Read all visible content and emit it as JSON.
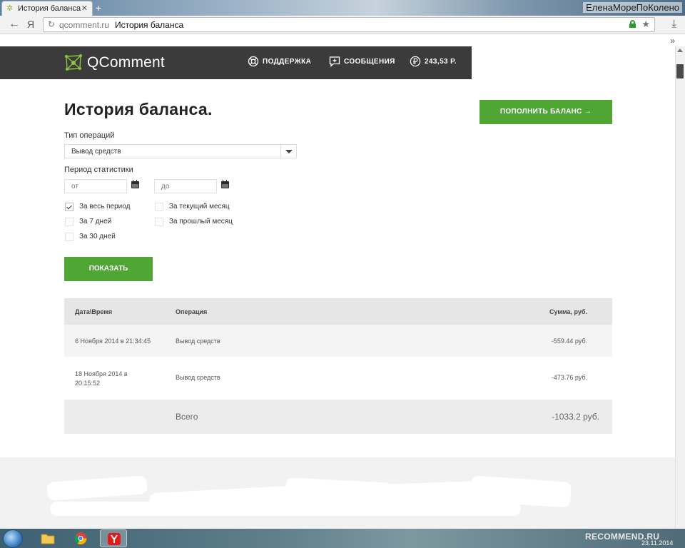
{
  "browser": {
    "tab_title": "История баланса",
    "profile_name": "ЕленаМореПоКолено",
    "ya_label": "Я",
    "url_domain": "qcomment.ru",
    "url_page_title": "История баланса",
    "new_tab": "+",
    "close_tab": "✕",
    "more": "»"
  },
  "header": {
    "logo": "QComment",
    "nav": [
      {
        "label": "ПОДДЕРЖКА",
        "icon": "lifebuoy-icon"
      },
      {
        "label": "СООБЩЕНИЯ",
        "icon": "message-plus-icon"
      },
      {
        "label": "243,53 Р.",
        "icon": "ruble-coin-icon"
      }
    ]
  },
  "page": {
    "title": "История баланса.",
    "topup_label": "ПОПОЛНИТЬ БАЛАНС →"
  },
  "filters": {
    "operation_type_label": "Тип операций",
    "operation_type_value": "Вывод средств",
    "period_label": "Период статистики",
    "from_placeholder": "от",
    "to_placeholder": "до",
    "checkboxes": [
      {
        "label": "За весь период",
        "checked": true
      },
      {
        "label": "За текущий месяц",
        "checked": false
      },
      {
        "label": "За 7 дней",
        "checked": false
      },
      {
        "label": "За прошлый месяц",
        "checked": false
      },
      {
        "label": "За 30 дней",
        "checked": false
      }
    ],
    "show_label": "ПОКАЗАТЬ"
  },
  "table": {
    "headers": {
      "date": "Дата\\Время",
      "operation": "Операция",
      "sum": "Сумма, руб."
    },
    "rows": [
      {
        "date": "6 Ноября 2014 в 21:34:45",
        "operation": "Вывод средств",
        "sum": "-559.44 руб."
      },
      {
        "date": "18 Ноября 2014 в 20:15:52",
        "operation": "Вывод средств",
        "sum": "-473.76 руб."
      }
    ],
    "total_label": "Всего",
    "total_value": "-1033.2 руб."
  },
  "taskbar": {
    "watermark": "RECOMMEND.RU",
    "date": "23.11.2014"
  },
  "colors": {
    "accent_green": "#4fa635",
    "header_dark": "#3b3b3b"
  }
}
